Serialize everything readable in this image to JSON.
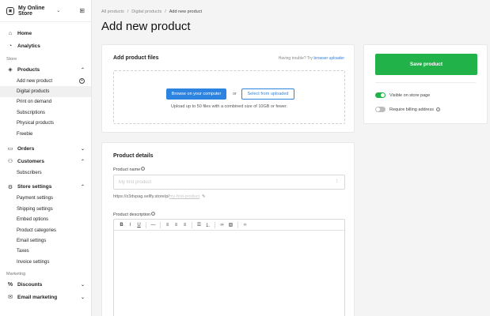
{
  "store": {
    "name": "My Online Store"
  },
  "sidebar": {
    "top_items": [
      {
        "label": "Home"
      },
      {
        "label": "Analytics"
      }
    ],
    "sections": {
      "store": "Store",
      "marketing": "Marketing"
    },
    "products": {
      "label": "Products",
      "sub_items": [
        {
          "label": "Add new product"
        },
        {
          "label": "Digital products"
        },
        {
          "label": "Print on demand"
        },
        {
          "label": "Subscriptions"
        },
        {
          "label": "Physical products"
        },
        {
          "label": "Freebie"
        }
      ]
    },
    "orders": {
      "label": "Orders"
    },
    "customers": {
      "label": "Customers",
      "sub_items": [
        {
          "label": "Subscribers"
        }
      ]
    },
    "store_settings": {
      "label": "Store settings",
      "sub_items": [
        {
          "label": "Payment settings"
        },
        {
          "label": "Shipping settings"
        },
        {
          "label": "Embed options"
        },
        {
          "label": "Product categories"
        },
        {
          "label": "Email settings"
        },
        {
          "label": "Taxes"
        },
        {
          "label": "Invoice settings"
        }
      ]
    },
    "marketing_items": [
      {
        "label": "Discounts"
      },
      {
        "label": "Email marketing"
      }
    ]
  },
  "breadcrumb": {
    "items": [
      "All products",
      "Digital products",
      "Add new product"
    ],
    "separator": "/"
  },
  "page_title": "Add new product",
  "files_card": {
    "title": "Add product files",
    "help_text": "Having trouble? Try",
    "help_link": "browser uploader",
    "browse_label": "Browse on your computer",
    "or_label": "or",
    "select_label": "Select from uploaded",
    "note": "Upload up to 50 files with a combined size of 10GB or fewer."
  },
  "details_card": {
    "title": "Product details",
    "name_label": "Product name",
    "name_placeholder": "My first product",
    "url_prefix": "https://z3dvpag.sellfy.store/p/",
    "url_slug": "my-first-product",
    "description_label": "Product description"
  },
  "save_card": {
    "save_label": "Save product",
    "visible_label": "Visible on store page",
    "visible_on": true,
    "billing_label": "Require billing address",
    "billing_on": false
  },
  "colors": {
    "accent_green": "#21b24a",
    "accent_blue": "#2d84e0"
  },
  "icons": {
    "home": "home-icon",
    "analytics": "analytics-icon",
    "products": "tag-icon",
    "orders": "cart-icon",
    "customers": "users-icon",
    "store_settings": "gear-icon",
    "discounts": "discount-icon",
    "email": "mail-icon"
  }
}
